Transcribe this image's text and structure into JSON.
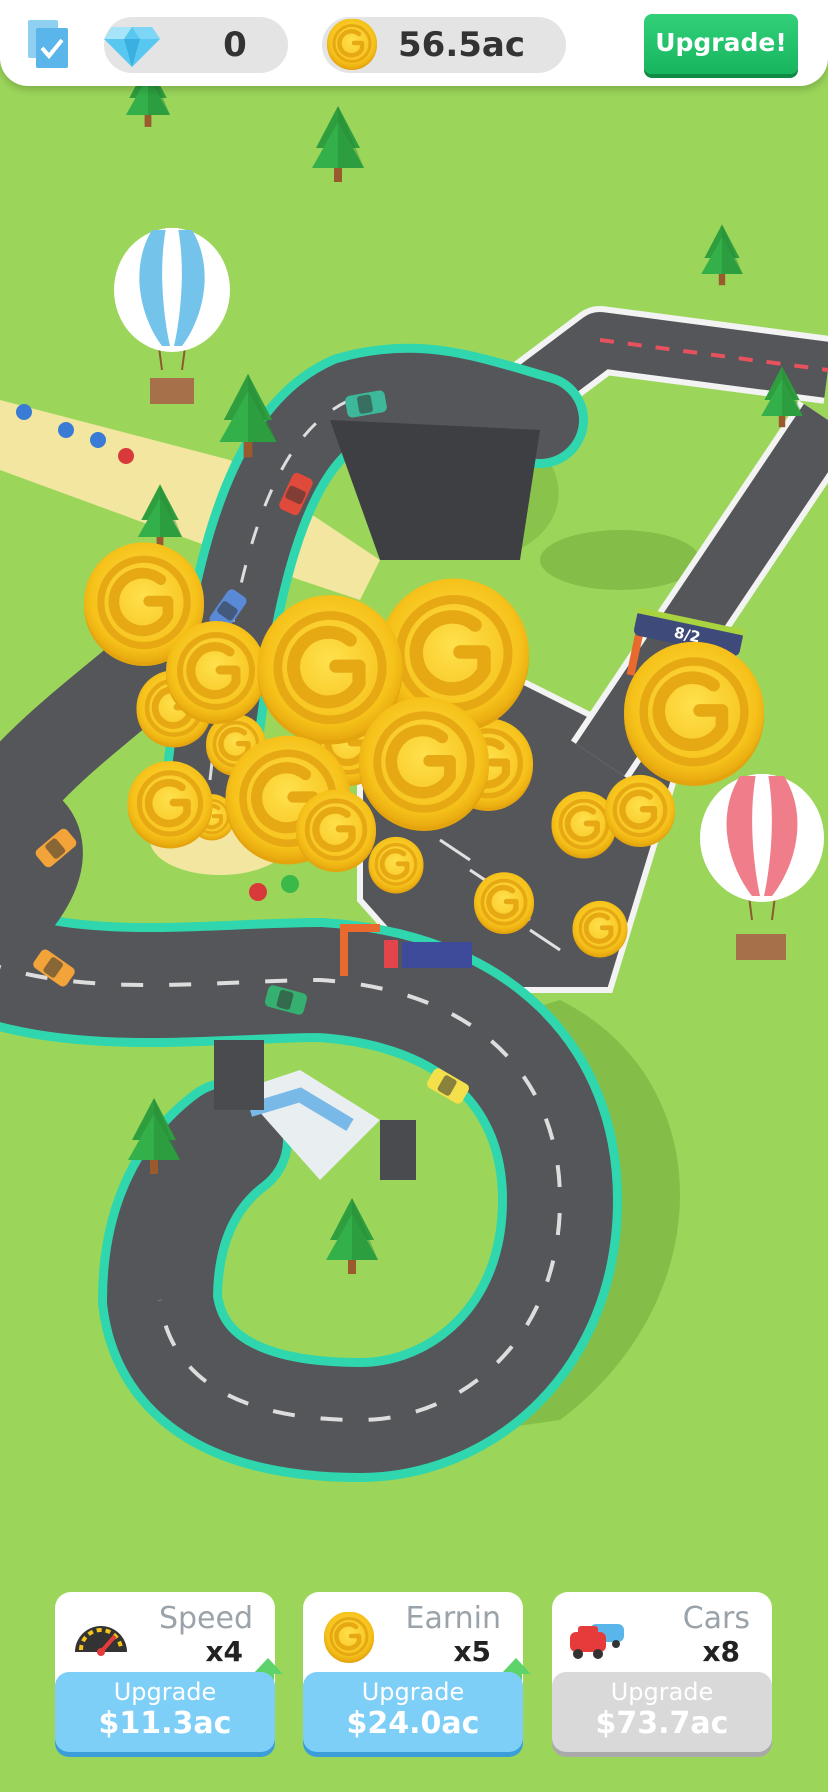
{
  "hud": {
    "gems": "0",
    "coins": "56.5ac",
    "upgrade_label": "Upgrade!"
  },
  "cards": [
    {
      "title": "Speed",
      "multiplier": "x4",
      "button_label": "Upgrade",
      "price": "$11.3ac",
      "icon": "speedometer-icon",
      "state": "available"
    },
    {
      "title": "Earnin",
      "multiplier": "x5",
      "button_label": "Upgrade",
      "price": "$24.0ac",
      "icon": "coin-icon",
      "state": "available"
    },
    {
      "title": "Cars",
      "multiplier": "x8",
      "button_label": "Upgrade",
      "price": "$73.7ac",
      "icon": "cars-icon",
      "state": "disabled"
    }
  ],
  "scene": {
    "gate_counter": "8/2",
    "coin_letter": "G"
  },
  "colors": {
    "grass": "#9bd65a",
    "road": "#555659",
    "track_border": "#2fd6ae",
    "coin": "#f5c518",
    "upgrade_green": "#1fbf68",
    "button_blue": "#7ecff7",
    "button_gray": "#d9d9d9"
  }
}
